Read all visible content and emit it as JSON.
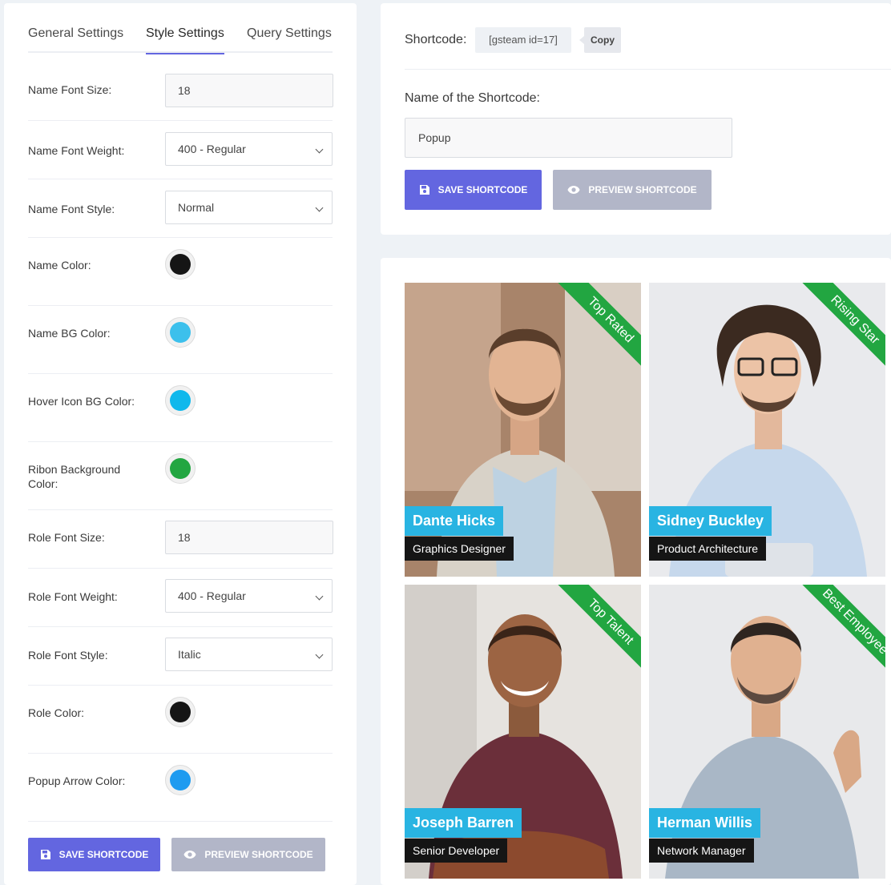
{
  "tabs": [
    {
      "label": "General Settings"
    },
    {
      "label": "Style Settings"
    },
    {
      "label": "Query Settings"
    }
  ],
  "settings": {
    "name_font_size": {
      "label": "Name Font Size:",
      "value": "18"
    },
    "name_font_weight": {
      "label": "Name Font Weight:",
      "value": "400 - Regular"
    },
    "name_font_style": {
      "label": "Name Font Style:",
      "value": "Normal"
    },
    "name_color": {
      "label": "Name Color:",
      "color": "#151515"
    },
    "name_bg_color": {
      "label": "Name BG Color:",
      "color": "#29b4e2"
    },
    "hover_icon_bg_color": {
      "label": "Hover Icon BG Color:",
      "color": "#0fb8ec"
    },
    "ribbon_bg_color": {
      "label": "Ribon Background Color:",
      "color": "#22a641"
    },
    "role_font_size": {
      "label": "Role Font Size:",
      "value": "18"
    },
    "role_font_weight": {
      "label": "Role Font Weight:",
      "value": "400 - Regular"
    },
    "role_font_style": {
      "label": "Role Font Style:",
      "value": "Italic"
    },
    "role_color": {
      "label": "Role Color:",
      "color": "#151515"
    },
    "popup_arrow_color": {
      "label": "Popup Arrow Color:",
      "color": "#1e9bf0"
    }
  },
  "buttons": {
    "save": "SAVE SHORTCODE",
    "preview": "PREVIEW SHORTCODE"
  },
  "shortcode": {
    "label": "Shortcode:",
    "code": "[gsteam id=17]",
    "copy": "Copy",
    "name_label": "Name of the Shortcode:",
    "name_value": "Popup"
  },
  "team": [
    {
      "name": "Dante Hicks",
      "role": "Graphics Designer",
      "ribbon": "Top Rated"
    },
    {
      "name": "Sidney Buckley",
      "role": "Product Architecture",
      "ribbon": "Rising Star"
    },
    {
      "name": "Joseph Barren",
      "role": "Senior Developer",
      "ribbon": "Top Talent"
    },
    {
      "name": "Herman Willis",
      "role": "Network Manager",
      "ribbon": "Best Employee"
    }
  ],
  "colors": {
    "accent": "#6366e0",
    "ribbon": "#22a641",
    "name_bg": "#29b4e2",
    "role_bg": "#151515"
  }
}
